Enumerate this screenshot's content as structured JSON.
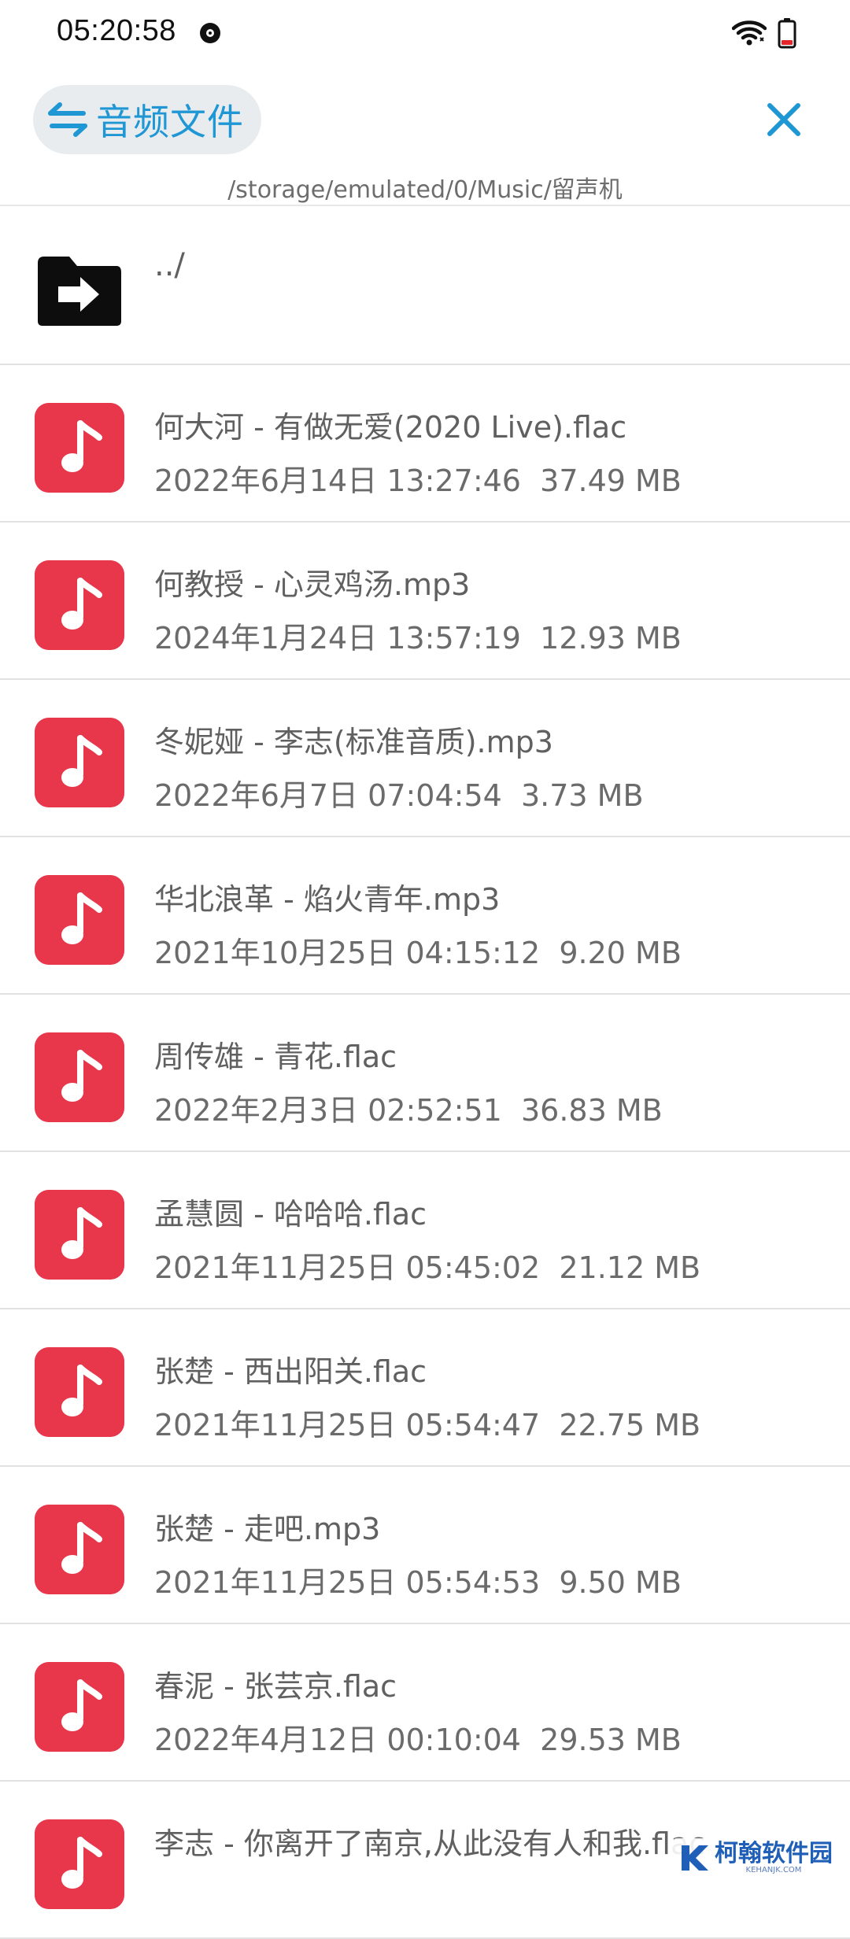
{
  "status_bar": {
    "time": "05:20:58",
    "icons": [
      "media-record-icon",
      "wifi-icon",
      "battery-low-icon"
    ]
  },
  "header": {
    "type_chip_label": "音频文件",
    "type_chip_icon": "swap-arrows-icon",
    "close_icon": "close-icon"
  },
  "path": "/storage/emulated/0/Music/留声机",
  "colors": {
    "accent": "#1f97d4",
    "music_icon": "#e8374b",
    "chip_bg": "#e9ecee"
  },
  "list": {
    "parent_label": "../",
    "files": [
      {
        "name": "何大河 - 有做无爱(2020 Live).flac",
        "date": "2022年6月14日 13:27:46",
        "size": "37.49 MB"
      },
      {
        "name": "何教授 - 心灵鸡汤.mp3",
        "date": "2024年1月24日 13:57:19",
        "size": "12.93 MB"
      },
      {
        "name": "冬妮娅 - 李志(标准音质).mp3",
        "date": "2022年6月7日 07:04:54",
        "size": "3.73 MB"
      },
      {
        "name": "华北浪革 - 焰火青年.mp3",
        "date": "2021年10月25日 04:15:12",
        "size": "9.20 MB"
      },
      {
        "name": "周传雄 - 青花.flac",
        "date": "2022年2月3日 02:52:51",
        "size": "36.83 MB"
      },
      {
        "name": "孟慧圆 - 哈哈哈.flac",
        "date": "2021年11月25日 05:45:02",
        "size": "21.12 MB"
      },
      {
        "name": "张楚 - 西出阳关.flac",
        "date": "2021年11月25日 05:54:47",
        "size": "22.75 MB"
      },
      {
        "name": "张楚 - 走吧.mp3",
        "date": "2021年11月25日 05:54:53",
        "size": "9.50 MB"
      },
      {
        "name": "春泥 - 张芸京.flac",
        "date": "2022年4月12日 00:10:04",
        "size": "29.53 MB"
      },
      {
        "name": "李志 - 你离开了南京,从此没有人和我.flac",
        "date": "",
        "size": ""
      }
    ]
  },
  "watermark": {
    "text": "柯翰软件园",
    "sub": "KEHANJK.COM"
  }
}
